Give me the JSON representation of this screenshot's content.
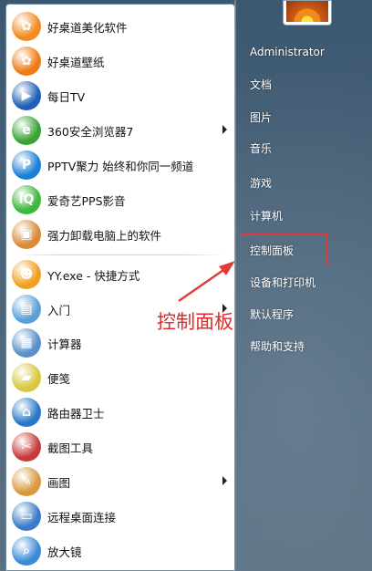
{
  "start_menu": {
    "programs": [
      {
        "label": "好桌道美化软件",
        "icon": "haozhuodao-beautify-icon",
        "color": "#f28a1c"
      },
      {
        "label": "好桌道壁纸",
        "icon": "haozhuodao-wallpaper-icon",
        "color": "#f07a14"
      },
      {
        "label": "每日TV",
        "icon": "meiri-tv-icon",
        "color": "#1f5fb8"
      },
      {
        "label": "360安全浏览器7",
        "icon": "360-browser-icon",
        "color": "#3aa336",
        "submenu": true
      },
      {
        "label": "PPTV聚力 始终和你同一频道",
        "icon": "pptv-icon",
        "color": "#1a7fd6"
      },
      {
        "label": "爱奇艺PPS影音",
        "icon": "iqiyi-pps-icon",
        "color": "#3db83a"
      },
      {
        "label": "强力卸载电脑上的软件",
        "icon": "uninstall-box-icon",
        "color": "#d88a3a"
      },
      {
        "label": "YY.exe - 快捷方式",
        "icon": "yy-icon",
        "color": "#f0a020"
      },
      {
        "label": "入门",
        "icon": "getting-started-icon",
        "color": "#5aa0d8",
        "submenu": true
      },
      {
        "label": "计算器",
        "icon": "calculator-icon",
        "color": "#5a8fc8"
      },
      {
        "label": "便笺",
        "icon": "sticky-notes-icon",
        "color": "#d8c840"
      },
      {
        "label": "路由器卫士",
        "icon": "router-guard-icon",
        "color": "#2a78c8"
      },
      {
        "label": "截图工具",
        "icon": "snipping-tool-icon",
        "color": "#c83a3a"
      },
      {
        "label": "画图",
        "icon": "paint-icon",
        "color": "#d89a40",
        "submenu": true
      },
      {
        "label": "远程桌面连接",
        "icon": "remote-desktop-icon",
        "color": "#3a7ac8"
      },
      {
        "label": "放大镜",
        "icon": "magnifier-icon",
        "color": "#3a8ad8"
      }
    ],
    "right_items": [
      {
        "label": "Administrator",
        "key": "administrator"
      },
      {
        "label": "文档",
        "key": "documents"
      },
      {
        "label": "图片",
        "key": "pictures"
      },
      {
        "label": "音乐",
        "key": "music"
      },
      {
        "label": "游戏",
        "key": "games"
      },
      {
        "label": "计算机",
        "key": "computer"
      },
      {
        "label": "控制面板",
        "key": "control-panel"
      },
      {
        "label": "设备和打印机",
        "key": "devices-printers"
      },
      {
        "label": "默认程序",
        "key": "default-programs"
      },
      {
        "label": "帮助和支持",
        "key": "help-support"
      }
    ],
    "annotation": "控制面板",
    "annotation_color": "#e02a2a"
  }
}
